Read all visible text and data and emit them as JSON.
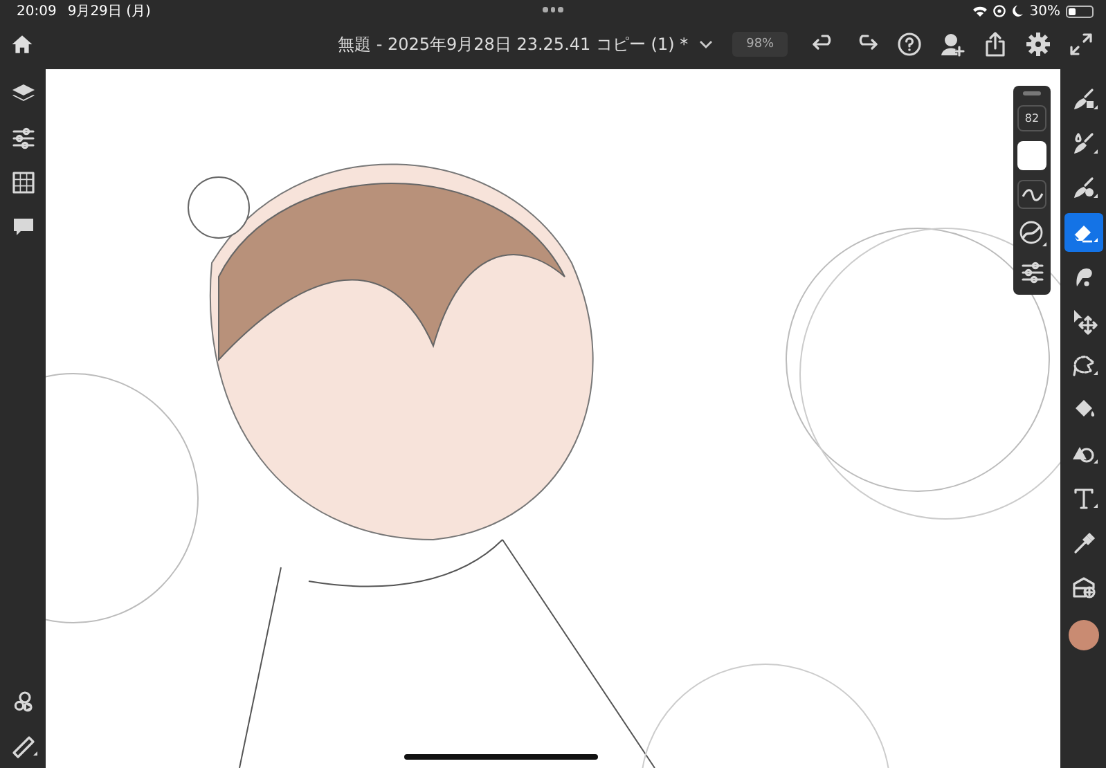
{
  "status_bar": {
    "time": "20:09",
    "date": "9月29日 (月)",
    "battery": "30%"
  },
  "top_bar": {
    "title": "無題 - 2025年9月28日 23.25.41 コピー (1) *",
    "zoom": "98%",
    "actions": [
      {
        "kind": "undo"
      },
      {
        "kind": "redo"
      },
      {
        "kind": "help"
      },
      {
        "kind": "invite"
      },
      {
        "kind": "share"
      },
      {
        "kind": "settings"
      },
      {
        "kind": "fullscreen"
      }
    ]
  },
  "left_toolbar": {
    "top": [
      {
        "kind": "layers"
      },
      {
        "kind": "adjust"
      },
      {
        "kind": "grid"
      },
      {
        "kind": "comment"
      }
    ],
    "bottom": [
      {
        "kind": "motion"
      },
      {
        "kind": "ruler"
      }
    ]
  },
  "brush_panel": {
    "size": "82",
    "color": "#ffffff"
  },
  "right_toolbar": {
    "tools": [
      {
        "kind": "pixel-brush",
        "selected": false
      },
      {
        "kind": "live-brush",
        "selected": false
      },
      {
        "kind": "vector-brush",
        "selected": false
      },
      {
        "kind": "eraser",
        "selected": true
      },
      {
        "kind": "smudge",
        "selected": false
      },
      {
        "kind": "move",
        "selected": false
      },
      {
        "kind": "lasso",
        "selected": false
      },
      {
        "kind": "fill",
        "selected": false
      },
      {
        "kind": "shape",
        "selected": false
      },
      {
        "kind": "text",
        "selected": false
      },
      {
        "kind": "eyedropper",
        "selected": false
      },
      {
        "kind": "place-image",
        "selected": false
      }
    ],
    "color": "#c98b72"
  }
}
